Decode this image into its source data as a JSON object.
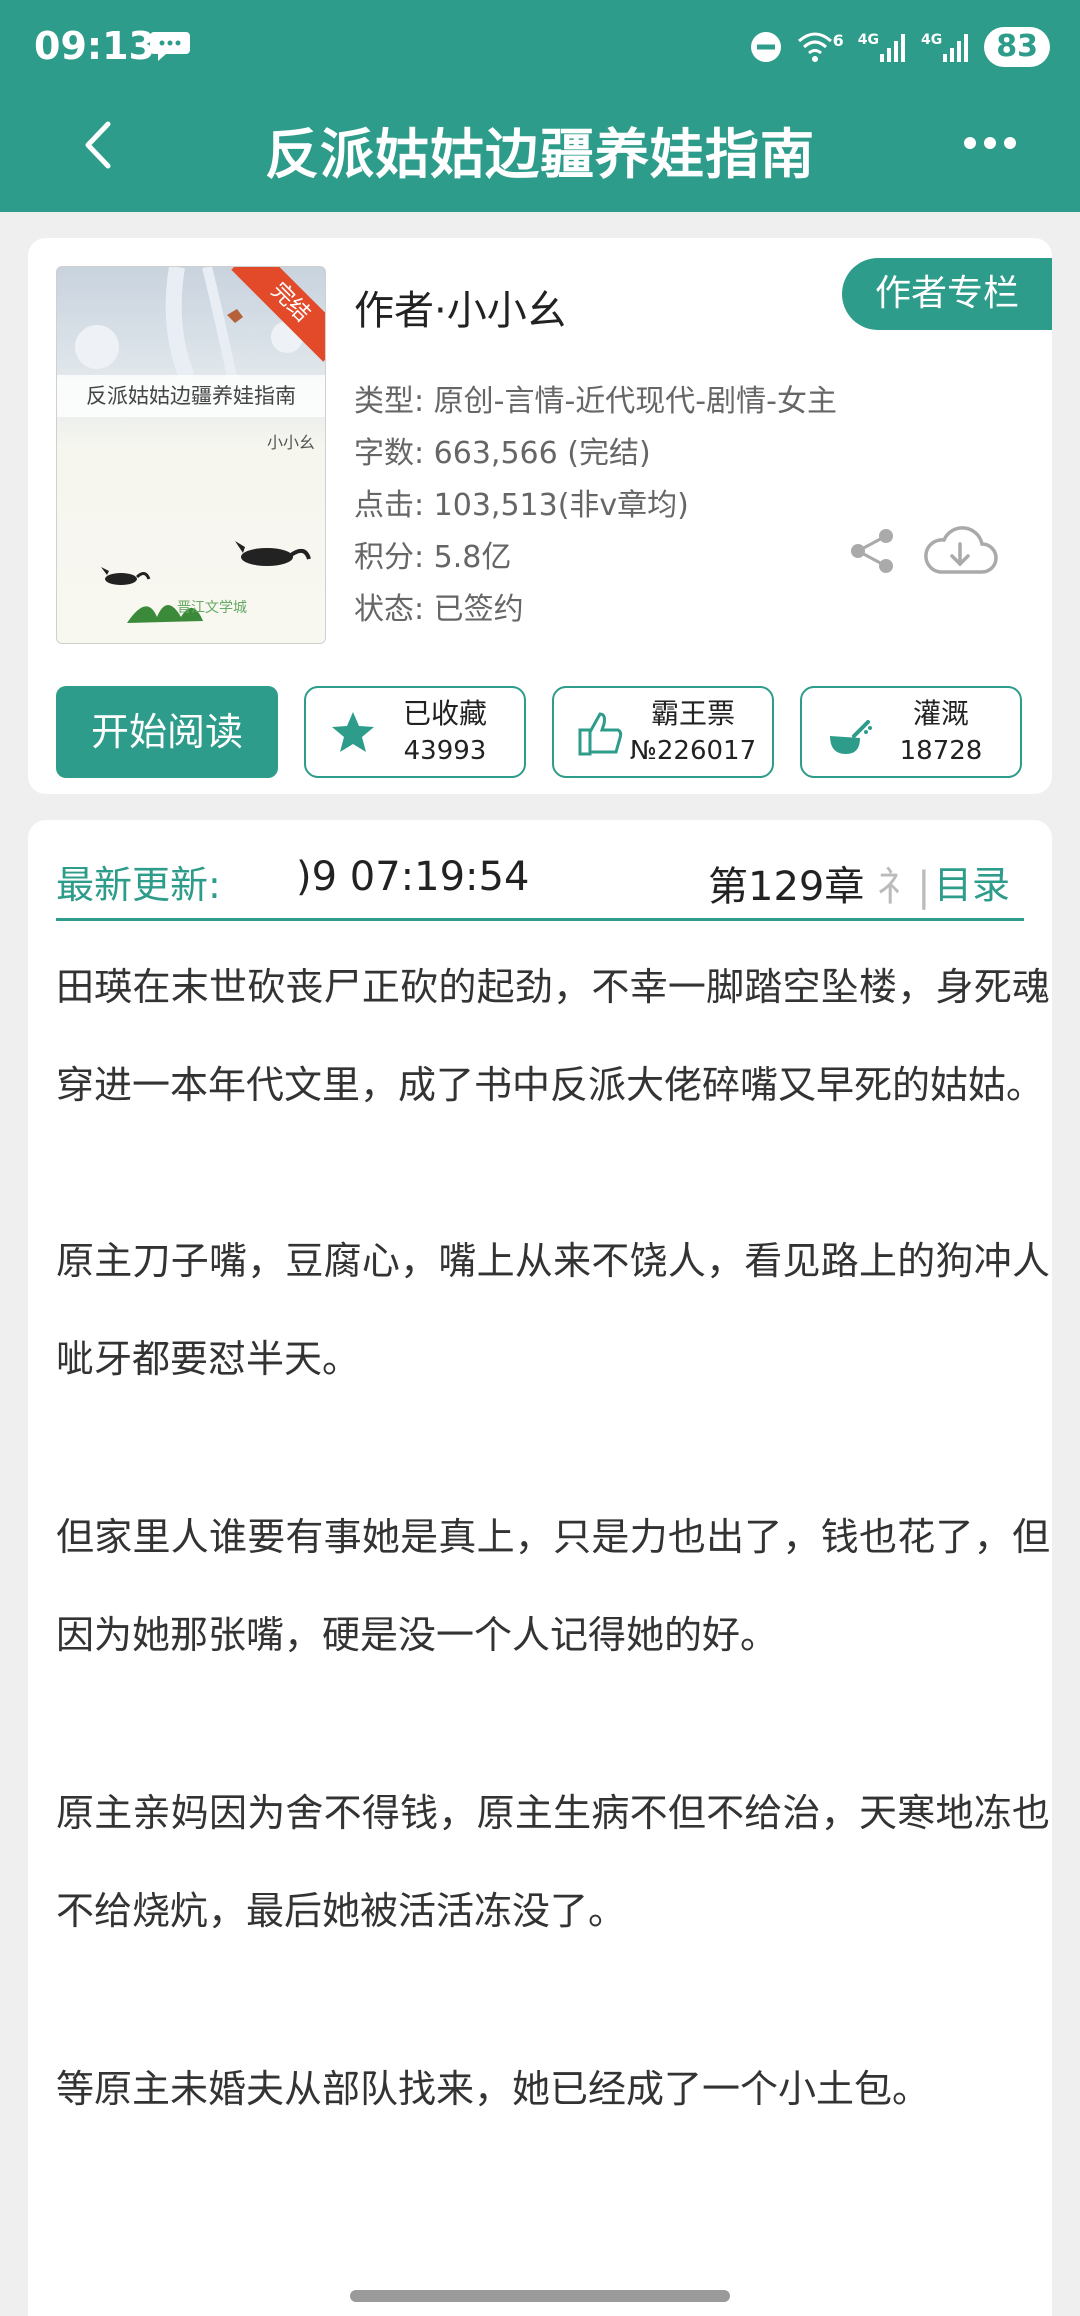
{
  "status_bar": {
    "time": "09:13",
    "network1": "4G",
    "network2": "4G",
    "wifi_num": "6",
    "battery": "83"
  },
  "header": {
    "title": "反派姑姑边疆养娃指南"
  },
  "book": {
    "cover_title": "反派姑姑边疆养娃指南",
    "cover_author": "小小幺",
    "cover_badge": "完结",
    "cover_logo": "晋江文学城",
    "author": "作者·小小幺",
    "author_column_label": "作者专栏",
    "type": "类型: 原创-言情-近代现代-剧情-女主",
    "words": "字数: 663,566 (完结)",
    "clicks": "点击: 103,513(非v章均)",
    "score": "积分: 5.8亿",
    "status": "状态: 已签约"
  },
  "actions": {
    "read_label": "开始阅读",
    "favorite": {
      "label": "已收藏",
      "count": "43993"
    },
    "vote": {
      "label": "霸王票",
      "count": "№226017"
    },
    "water": {
      "label": "灌溉",
      "count": "18728"
    }
  },
  "update": {
    "label": "最新更新:",
    "time": ")9 07:19:54",
    "chapter": "第129章",
    "chapter_tail": "礻|",
    "toc_label": "目录"
  },
  "synopsis": [
    "田瑛在末世砍丧尸正砍的起劲，不幸一脚踏空坠楼，身死魂穿进一本年代文里，成了书中反派大佬碎嘴又早死的姑姑。",
    "原主刀子嘴，豆腐心，嘴上从来不饶人，看见路上的狗冲人呲牙都要怼半天。",
    "但家里人谁要有事她是真上，只是力也出了，钱也花了，但因为她那张嘴，硬是没一个人记得她的好。",
    "原主亲妈因为舍不得钱，原主生病不但不给治，天寒地冻也不给烧炕，最后她被活活冻没了。",
    "等原主未婚夫从部队找来，她已经成了一个小土包。"
  ],
  "colors": {
    "accent": "#2e9c8a",
    "badge": "#e24a2a"
  }
}
